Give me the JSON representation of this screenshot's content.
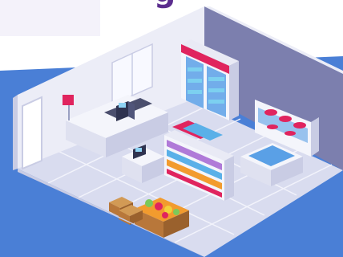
{
  "headline_fragment": "g",
  "colors": {
    "background_top": "#ffffff",
    "background_blue": "#4a7fd6",
    "heading_purple": "#5b2d8e",
    "wall_light": "#ecedf7",
    "wall_shadow": "#7c7fae",
    "floor": "#d9dcef",
    "floor_tile_line": "#f2f3fb",
    "counter_white": "#f4f5fb",
    "fridge_red": "#e0245e",
    "produce_orange": "#f29b2e",
    "crate_brown": "#b8773a",
    "freezer_blue": "#5aa0e6"
  },
  "icons": [
    "cash-register-icon",
    "shopping-basket-icon",
    "pos-terminal-icon"
  ]
}
